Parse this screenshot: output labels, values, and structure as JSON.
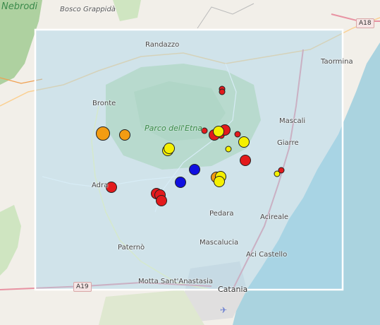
{
  "map": {
    "places": [
      {
        "id": "nebrodi",
        "label": "Nebrodi"
      },
      {
        "id": "bosco-grappida",
        "label": "Bosco Grappidà"
      },
      {
        "id": "randazzo",
        "label": "Randazzo"
      },
      {
        "id": "taormina",
        "label": "Taormina"
      },
      {
        "id": "bronte",
        "label": "Bronte"
      },
      {
        "id": "parco-etna",
        "label": "Parco dell'Etna"
      },
      {
        "id": "mascali",
        "label": "Mascali"
      },
      {
        "id": "giarre",
        "label": "Giarre"
      },
      {
        "id": "adrano",
        "label": "Adra"
      },
      {
        "id": "pedara",
        "label": "Pedara"
      },
      {
        "id": "acireale",
        "label": "Acireale"
      },
      {
        "id": "mascalucia",
        "label": "Mascalucia"
      },
      {
        "id": "aci-castello",
        "label": "Aci Castello"
      },
      {
        "id": "paterno",
        "label": "Paternò"
      },
      {
        "id": "motta",
        "label": "Motta Sant'Anastasia"
      },
      {
        "id": "catania",
        "label": "Catania"
      }
    ],
    "road_shields": [
      {
        "id": "a18",
        "label": "A18"
      },
      {
        "id": "a19",
        "label": "A19"
      }
    ],
    "colors": {
      "red": "#e31a1c",
      "orange": "#f39c12",
      "yellow": "#f5f000",
      "blue": "#1010e0",
      "highlight_box_fill": "#a6d4ea",
      "highlight_box_stroke": "#ffffff"
    },
    "markers": [
      {
        "color": "red",
        "size": "small"
      },
      {
        "color": "red",
        "size": "small"
      },
      {
        "color": "red",
        "size": "small"
      },
      {
        "color": "red",
        "size": "medium"
      },
      {
        "color": "red",
        "size": "small"
      },
      {
        "color": "red",
        "size": "medium"
      },
      {
        "color": "yellow",
        "size": "small"
      },
      {
        "color": "yellow",
        "size": "medium"
      },
      {
        "color": "red",
        "size": "small"
      },
      {
        "color": "yellow",
        "size": "medium"
      },
      {
        "color": "yellow",
        "size": "small"
      },
      {
        "color": "red",
        "size": "medium"
      },
      {
        "color": "orange",
        "size": "large"
      },
      {
        "color": "orange",
        "size": "medium"
      },
      {
        "color": "yellow",
        "size": "medium"
      },
      {
        "color": "yellow",
        "size": "medium"
      },
      {
        "color": "blue",
        "size": "medium"
      },
      {
        "color": "blue",
        "size": "medium"
      },
      {
        "color": "orange",
        "size": "medium"
      },
      {
        "color": "yellow",
        "size": "medium"
      },
      {
        "color": "yellow",
        "size": "medium"
      },
      {
        "color": "red",
        "size": "medium"
      },
      {
        "color": "red",
        "size": "medium"
      },
      {
        "color": "red",
        "size": "medium"
      },
      {
        "color": "red",
        "size": "medium"
      },
      {
        "color": "yellow",
        "size": "small"
      },
      {
        "color": "red",
        "size": "small"
      }
    ],
    "airport_icon": "airplane-icon"
  }
}
